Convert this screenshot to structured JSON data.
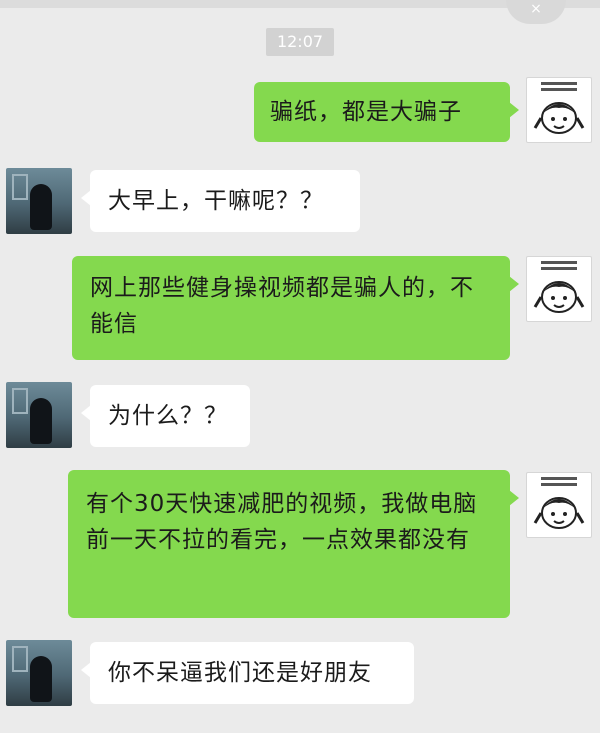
{
  "chat": {
    "timestamp": "12:07",
    "messages": [
      {
        "side": "right",
        "text": "骗纸，都是大骗子"
      },
      {
        "side": "left",
        "text": "大早上，干嘛呢？？"
      },
      {
        "side": "right",
        "text": "网上那些健身操视频都是骗人的，不能信"
      },
      {
        "side": "left",
        "text": "为什么？？"
      },
      {
        "side": "right",
        "text": "有个30天快速减肥的视频，我做电脑前一天不拉的看完，一点效果都没有"
      },
      {
        "side": "left",
        "text": "你不呆逼我们还是好朋友"
      }
    ]
  },
  "colors": {
    "outgoing_bubble": "#84d94e",
    "incoming_bubble": "#ffffff",
    "background": "#ebebeb"
  },
  "icons": {
    "corner": "close-icon",
    "self_avatar": "meme-avatar-icon",
    "friend_avatar": "photo-avatar-icon"
  }
}
